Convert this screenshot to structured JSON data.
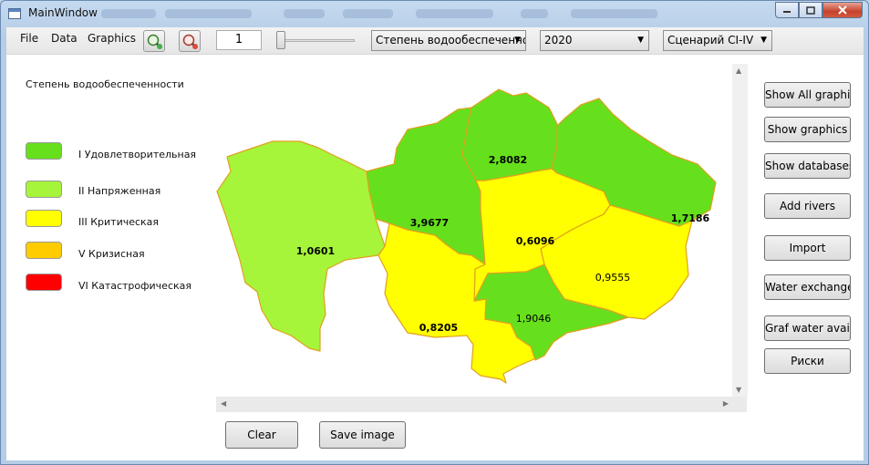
{
  "window": {
    "title": "MainWindow"
  },
  "menu": {
    "file": "File",
    "data": "Data",
    "graphics": "Graphics"
  },
  "toolbar": {
    "number_value": "1",
    "indicator_combo": "Степень водообеспеченность",
    "year_combo": "2020",
    "scenario_combo": "Сценарий CI-IV"
  },
  "legend": {
    "title": "Степень водообеспеченности",
    "items": [
      {
        "label": "I Удовлетворительная",
        "color": "#66e01c"
      },
      {
        "label": "II Напряженная",
        "color": "#a6f53a"
      },
      {
        "label": "III Критическая",
        "color": "#ffff00"
      },
      {
        "label": "V Кризисная",
        "color": "#ffcc00"
      },
      {
        "label": "VI Катастрофическая",
        "color": "#ff0000"
      }
    ]
  },
  "map": {
    "regions": [
      {
        "value": "1,0601",
        "class": "II",
        "color": "#a6f53a"
      },
      {
        "value": "3,9677",
        "class": "I",
        "color": "#66e01c"
      },
      {
        "value": "2,8082",
        "class": "I",
        "color": "#66e01c"
      },
      {
        "value": "1,7186",
        "class": "I",
        "color": "#66e01c"
      },
      {
        "value": "0,6096",
        "class": "III",
        "color": "#ffff00"
      },
      {
        "value": "0,9555",
        "class": "III",
        "color": "#ffff00"
      },
      {
        "value": "0,8205",
        "class": "III",
        "color": "#ffff00"
      },
      {
        "value": "1,9046",
        "class": "I",
        "color": "#66e01c"
      }
    ]
  },
  "side_buttons": {
    "show_all": "Show All graphic",
    "show_graphics": "Show graphics",
    "show_databases": "Show databases",
    "add_rivers": "Add rivers",
    "import": "Import",
    "water_exchange": "Water exchange",
    "graf_water": "Graf water availa",
    "risks": "Риски"
  },
  "bottom_buttons": {
    "clear": "Clear",
    "save_image": "Save image"
  }
}
